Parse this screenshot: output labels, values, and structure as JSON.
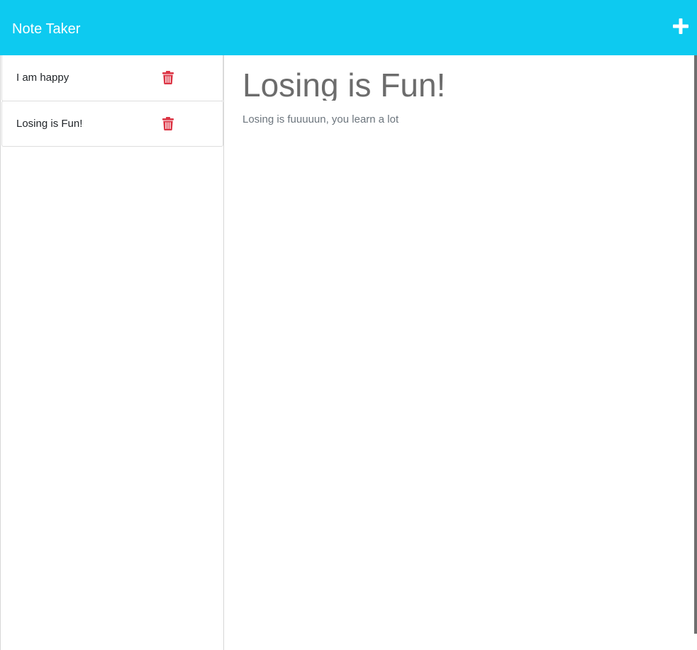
{
  "app": {
    "title": "Note Taker"
  },
  "toolbar": {
    "new_note_icon": "plus-icon"
  },
  "notes": [
    {
      "title": "I am happy",
      "delete_icon": "trash-icon"
    },
    {
      "title": "Losing is Fun!",
      "delete_icon": "trash-icon"
    }
  ],
  "active_note": {
    "title": "Losing is Fun!",
    "text": "Losing is fuuuuun, you learn a lot"
  },
  "colors": {
    "navbar": "#0dcaf0",
    "delete": "#dc3545",
    "heading_text": "#6c6c6c"
  }
}
